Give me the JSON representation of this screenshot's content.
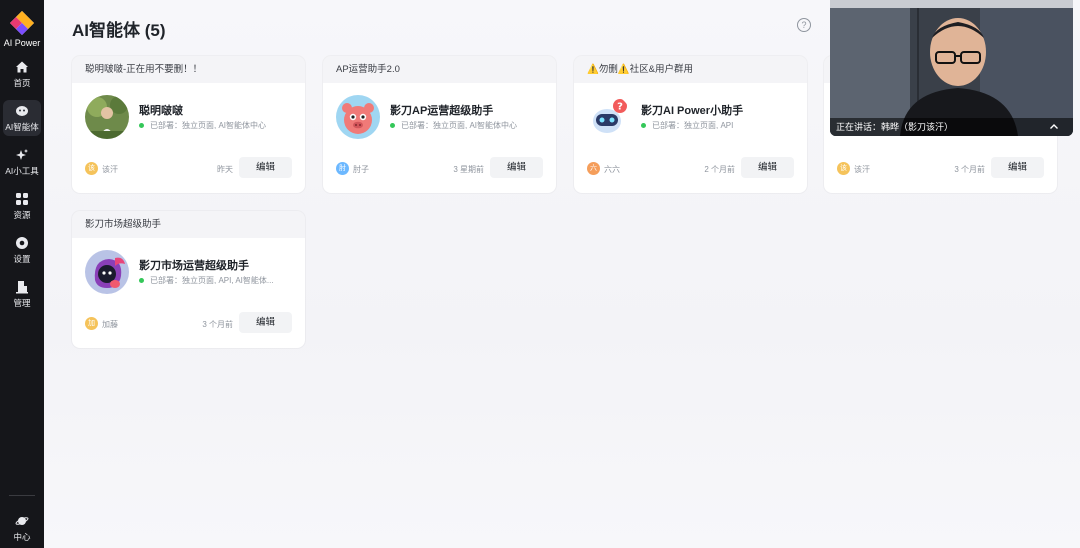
{
  "app": {
    "name": "AI Power"
  },
  "sidebar": {
    "items": [
      {
        "label": "首页",
        "icon": "home-icon"
      },
      {
        "label": "AI智能体",
        "icon": "agent-icon",
        "active": true
      },
      {
        "label": "AI小工具",
        "icon": "sparkle-icon"
      },
      {
        "label": "资源",
        "icon": "grid-icon"
      },
      {
        "label": "设置",
        "icon": "gear-icon"
      },
      {
        "label": "管理",
        "icon": "building-icon"
      }
    ],
    "bottom": {
      "label": "中心",
      "icon": "planet-icon"
    }
  },
  "header": {
    "title": "AI智能体 (5)",
    "help": "?"
  },
  "cards": [
    {
      "group": "聪明啵啵-正在用不要删！！",
      "name": "聪明啵啵",
      "status": "已部署：独立页面, AI智能体中心",
      "owner": "该汗",
      "owner_initial": "该",
      "owner_color": "#f5c35b",
      "time": "昨天",
      "edit": "编辑",
      "avatar": "photo"
    },
    {
      "group": "AP运营助手2.0",
      "name": "影刀AP运营超级助手",
      "status": "已部署：独立页面, AI智能体中心",
      "owner": "肘子",
      "owner_initial": "肘",
      "owner_color": "#6cb8ff",
      "time": "3 星期前",
      "edit": "编辑",
      "avatar": "pig"
    },
    {
      "group": "⚠️勿删⚠️社区&用户群用",
      "name": "影刀AI Power小助手",
      "status": "已部署：独立页面, API",
      "owner": "六六",
      "owner_initial": "六",
      "owner_color": "#f59e5b",
      "time": "2 个月前",
      "edit": "编辑",
      "avatar": "robot"
    },
    {
      "group": "",
      "name": "",
      "status": "",
      "owner": "该汗",
      "owner_initial": "该",
      "owner_color": "#f5c35b",
      "time": "3 个月前",
      "edit": "编辑",
      "avatar": "hidden"
    },
    {
      "group": "影刀市场超级助手",
      "name": "影刀市场运营超级助手",
      "status": "已部署：独立页面, API, AI智能体...",
      "owner": "加藤",
      "owner_initial": "加",
      "owner_color": "#f5c35b",
      "time": "3 个月前",
      "edit": "编辑",
      "avatar": "character"
    }
  ],
  "video": {
    "caption": "正在讲话：韩晔（影刀该汗）"
  }
}
